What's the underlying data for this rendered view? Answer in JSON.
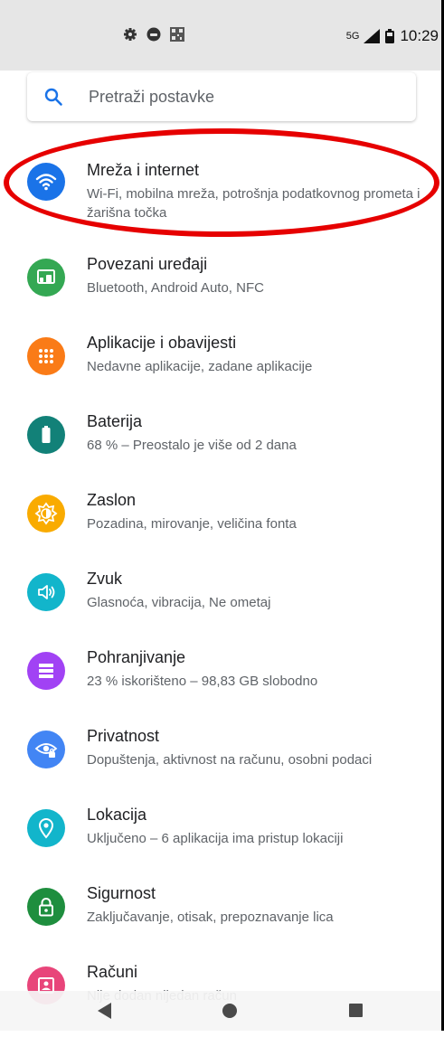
{
  "status_bar": {
    "icons_left": [
      "gear-icon",
      "game-controller-icon",
      "qr-code-icon"
    ],
    "network": "5G",
    "time": "10:29"
  },
  "search": {
    "placeholder": "Pretraži postavke",
    "icon": "search-icon"
  },
  "items": [
    {
      "title": "Mreža i internet",
      "subtitle": "Wi-Fi, mobilna mreža, potrošnja podatkovnog prometa i žarišna točka",
      "icon": "wifi-icon",
      "color": "#1a73e8"
    },
    {
      "title": "Povezani uređaji",
      "subtitle": "Bluetooth, Android Auto, NFC",
      "icon": "devices-icon",
      "color": "#34a853"
    },
    {
      "title": "Aplikacije i obavijesti",
      "subtitle": "Nedavne aplikacije, zadane aplikacije",
      "icon": "apps-icon",
      "color": "#fa7b17"
    },
    {
      "title": "Baterija",
      "subtitle": "68 % – Preostalo je više od 2 dana",
      "icon": "battery-icon",
      "color": "#128178"
    },
    {
      "title": "Zaslon",
      "subtitle": "Pozadina, mirovanje, veličina fonta",
      "icon": "brightness-icon",
      "color": "#f9ab00"
    },
    {
      "title": "Zvuk",
      "subtitle": "Glasnoća, vibracija, Ne ometaj",
      "icon": "volume-icon",
      "color": "#12b5cb"
    },
    {
      "title": "Pohranjivanje",
      "subtitle": "23 % iskorišteno – 98,83 GB slobodno",
      "icon": "storage-icon",
      "color": "#a142f4"
    },
    {
      "title": "Privatnost",
      "subtitle": "Dopuštenja, aktivnost na računu, osobni podaci",
      "icon": "privacy-eye-icon",
      "color": "#4285f4"
    },
    {
      "title": "Lokacija",
      "subtitle": "Uključeno – 6 aplikacija ima pristup lokaciji",
      "icon": "location-pin-icon",
      "color": "#12b5cb"
    },
    {
      "title": "Sigurnost",
      "subtitle": "Zaključavanje, otisak, prepoznavanje lica",
      "icon": "lock-icon",
      "color": "#1e8e3e"
    },
    {
      "title": "Računi",
      "subtitle": "Nije dodan nijedan račun",
      "icon": "account-icon",
      "color": "#e8457a"
    }
  ],
  "highlight_color": "#e60000"
}
